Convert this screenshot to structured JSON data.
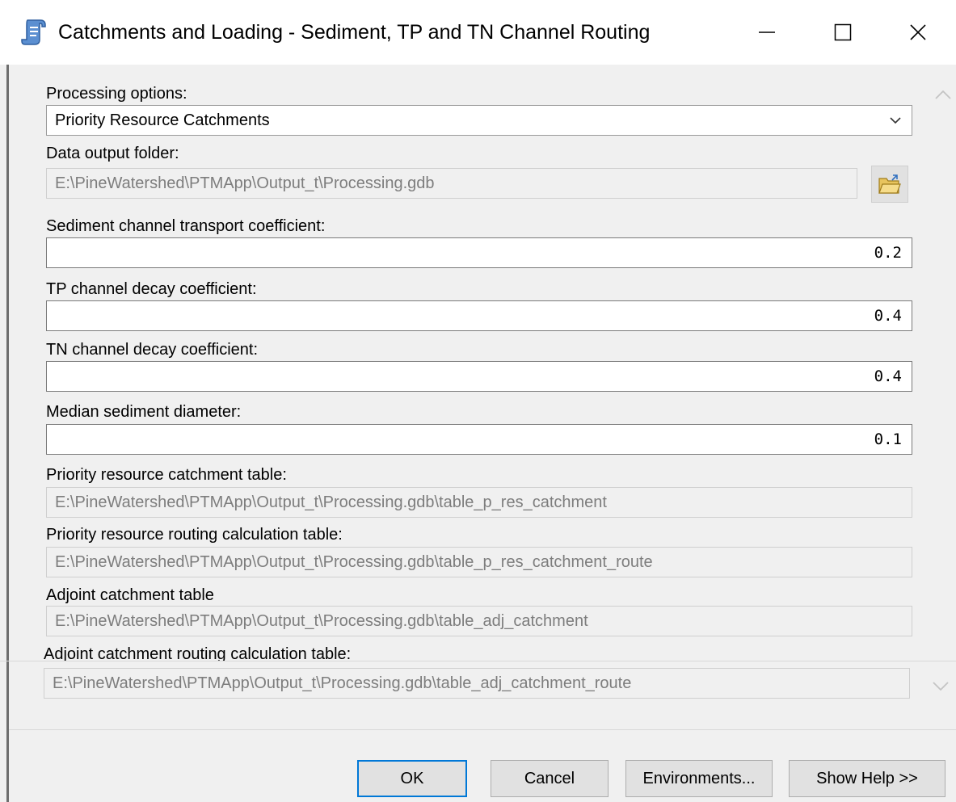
{
  "window": {
    "title": "Catchments and Loading - Sediment, TP and TN Channel Routing",
    "icon": "script-tool-icon"
  },
  "form": {
    "processing_options": {
      "label": "Processing options:",
      "value": "Priority Resource Catchments"
    },
    "data_output_folder": {
      "label": "Data output folder:",
      "value": "E:\\PineWatershed\\PTMApp\\Output_t\\Processing.gdb"
    },
    "sediment_coefficient": {
      "label": "Sediment channel transport coefficient:",
      "value": "0.2"
    },
    "tp_coefficient": {
      "label": "TP channel decay coefficient:",
      "value": "0.4"
    },
    "tn_coefficient": {
      "label": "TN channel decay coefficient:",
      "value": "0.4"
    },
    "median_diameter": {
      "label": "Median sediment diameter:",
      "value": "0.1"
    },
    "priority_catchment_table": {
      "label": "Priority resource catchment table:",
      "value": "E:\\PineWatershed\\PTMApp\\Output_t\\Processing.gdb\\table_p_res_catchment"
    },
    "priority_routing_table": {
      "label": "Priority resource routing calculation table:",
      "value": "E:\\PineWatershed\\PTMApp\\Output_t\\Processing.gdb\\table_p_res_catchment_route"
    },
    "adjoint_catchment_table": {
      "label": "Adjoint catchment table",
      "value": "E:\\PineWatershed\\PTMApp\\Output_t\\Processing.gdb\\table_adj_catchment"
    },
    "adjoint_routing_table": {
      "label": "Adjoint catchment routing calculation table:",
      "value": "E:\\PineWatershed\\PTMApp\\Output_t\\Processing.gdb\\table_adj_catchment_route"
    }
  },
  "buttons": {
    "ok": "OK",
    "cancel": "Cancel",
    "environments": "Environments...",
    "show_help": "Show Help >>"
  },
  "colors": {
    "default_button_border": "#0078d7",
    "dialog_background": "#f0f0f0"
  }
}
